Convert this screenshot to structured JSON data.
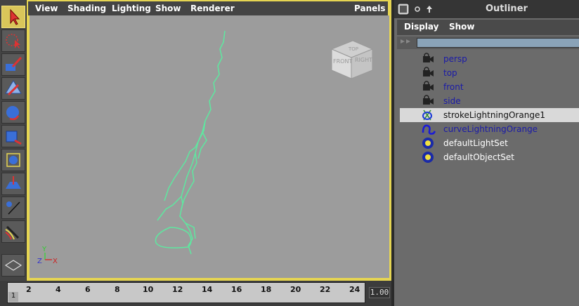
{
  "viewport": {
    "menu": [
      "View",
      "Shading",
      "Lighting",
      "Show",
      "Renderer"
    ],
    "panels_label": "Panels",
    "viewcube": {
      "front": "FRONT",
      "right": "RIGHT",
      "top": "TOP"
    },
    "axis": {
      "y": "Y",
      "z": "Z",
      "x": "X"
    }
  },
  "timeslider": {
    "ticks": [
      "2",
      "4",
      "6",
      "8",
      "10",
      "12",
      "14",
      "16",
      "18",
      "20",
      "22",
      "24"
    ],
    "current_frame": "1",
    "end_value": "1.00"
  },
  "outliner": {
    "title": "Outliner",
    "menu": [
      "Display",
      "Show"
    ],
    "items": [
      {
        "label": "persp",
        "icon": "camera-icon",
        "color": "#1a1aa8",
        "selected": false
      },
      {
        "label": "top",
        "icon": "camera-icon",
        "color": "#1a1aa8",
        "selected": false
      },
      {
        "label": "front",
        "icon": "camera-icon",
        "color": "#1a1aa8",
        "selected": false
      },
      {
        "label": "side",
        "icon": "camera-icon",
        "color": "#1a1aa8",
        "selected": false
      },
      {
        "label": "strokeLightningOrange1",
        "icon": "stroke-icon",
        "color": "#111111",
        "selected": true
      },
      {
        "label": "curveLightningOrange",
        "icon": "curve-icon",
        "color": "#1a1aa8",
        "selected": false
      },
      {
        "label": "defaultLightSet",
        "icon": "set-icon",
        "color": "#ffffff",
        "selected": false
      },
      {
        "label": "defaultObjectSet",
        "icon": "set-icon",
        "color": "#ffffff",
        "selected": false
      }
    ]
  },
  "colors": {
    "active_frame": "#e6d552",
    "stroke": "#5ee8a0",
    "viewport_bg": "#9c9c9c"
  }
}
